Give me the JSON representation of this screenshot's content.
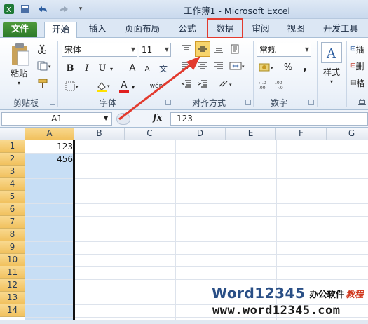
{
  "app": {
    "title": "工作簿1 - Microsoft Excel"
  },
  "tabs": [
    "文件",
    "开始",
    "插入",
    "页面布局",
    "公式",
    "数据",
    "审阅",
    "视图",
    "开发工具"
  ],
  "highlight_color": "#e23a2e",
  "ribbon": {
    "clipboard": {
      "label": "剪贴板",
      "paste_label": "粘贴"
    },
    "font": {
      "label": "字体",
      "font_name": "宋体",
      "font_size": "11",
      "bold": "B",
      "italic": "I",
      "underline": "U",
      "grow": "A",
      "shrink": "A",
      "font_color_icon": "A",
      "wen": "wén"
    },
    "alignment": {
      "label": "对齐方式"
    },
    "number": {
      "label": "数字",
      "format": "常规",
      "percent": "%",
      "comma": ","
    },
    "styles": {
      "label": "样式"
    },
    "cells": {
      "label": "单",
      "item1": "插",
      "item2": "删",
      "item3": "格"
    }
  },
  "formula_bar": {
    "name_box": "A1",
    "fx": "fx",
    "value": "123"
  },
  "grid": {
    "columns": [
      "A",
      "B",
      "C",
      "D",
      "E",
      "F",
      "G"
    ],
    "rows": [
      "1",
      "2",
      "3",
      "4",
      "5",
      "6",
      "7",
      "8",
      "9",
      "10",
      "11",
      "12",
      "13",
      "14"
    ],
    "cells": {
      "A1": "123",
      "A2": "456"
    }
  },
  "watermark": {
    "logo": "Word12345",
    "slogan": "办公软件",
    "slogan_accent": "教程",
    "url": "www.word12345.com"
  }
}
